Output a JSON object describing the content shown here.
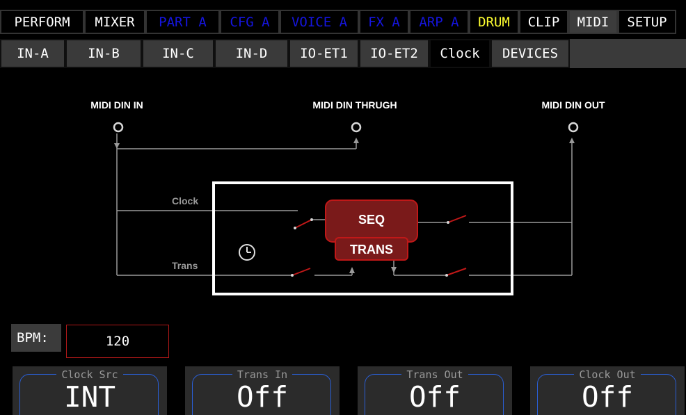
{
  "top_tabs": [
    {
      "label": "PERFORM",
      "color": "#ffffff",
      "active": false
    },
    {
      "label": "MIXER",
      "color": "#ffffff",
      "active": false
    },
    {
      "label": "PART A",
      "color": "#1515e0",
      "active": false
    },
    {
      "label": "CFG A",
      "color": "#1515e0",
      "active": false
    },
    {
      "label": "VOICE A",
      "color": "#1515e0",
      "active": false
    },
    {
      "label": "FX A",
      "color": "#1515e0",
      "active": false
    },
    {
      "label": "ARP A",
      "color": "#1515e0",
      "active": false
    },
    {
      "label": "DRUM",
      "color": "#ffff30",
      "active": false
    },
    {
      "label": "CLIP",
      "color": "#ffffff",
      "active": false
    },
    {
      "label": "MIDI",
      "color": "#ffffff",
      "active": true
    },
    {
      "label": "SETUP",
      "color": "#ffffff",
      "active": false
    }
  ],
  "sub_tabs": [
    {
      "label": "IN-A",
      "active": false
    },
    {
      "label": "IN-B",
      "active": false
    },
    {
      "label": "IN-C",
      "active": false
    },
    {
      "label": "IN-D",
      "active": false
    },
    {
      "label": "IO-ET1",
      "active": false
    },
    {
      "label": "IO-ET2",
      "active": false
    },
    {
      "label": "Clock",
      "active": true
    },
    {
      "label": "DEVICES",
      "active": false
    }
  ],
  "diagram": {
    "midi_in": "MIDI DIN IN",
    "midi_through": "MIDI DIN THRUGH",
    "midi_out": "MIDI DIN OUT",
    "clock_label": "Clock",
    "trans_label": "Trans",
    "seq_label": "SEQ",
    "trans_block_label": "TRANS"
  },
  "bpm": {
    "label": "BPM:",
    "value": "120"
  },
  "knobs": [
    {
      "title": "Clock Src",
      "value": "INT"
    },
    {
      "title": "Trans In",
      "value": "Off"
    },
    {
      "title": "Trans Out",
      "value": "Off"
    },
    {
      "title": "Clock Out",
      "value": "Off"
    }
  ],
  "colors": {
    "accent_blue": "#2a5fd6",
    "seq_red": "#7a1a1a",
    "drum_yellow": "#ffff30"
  }
}
